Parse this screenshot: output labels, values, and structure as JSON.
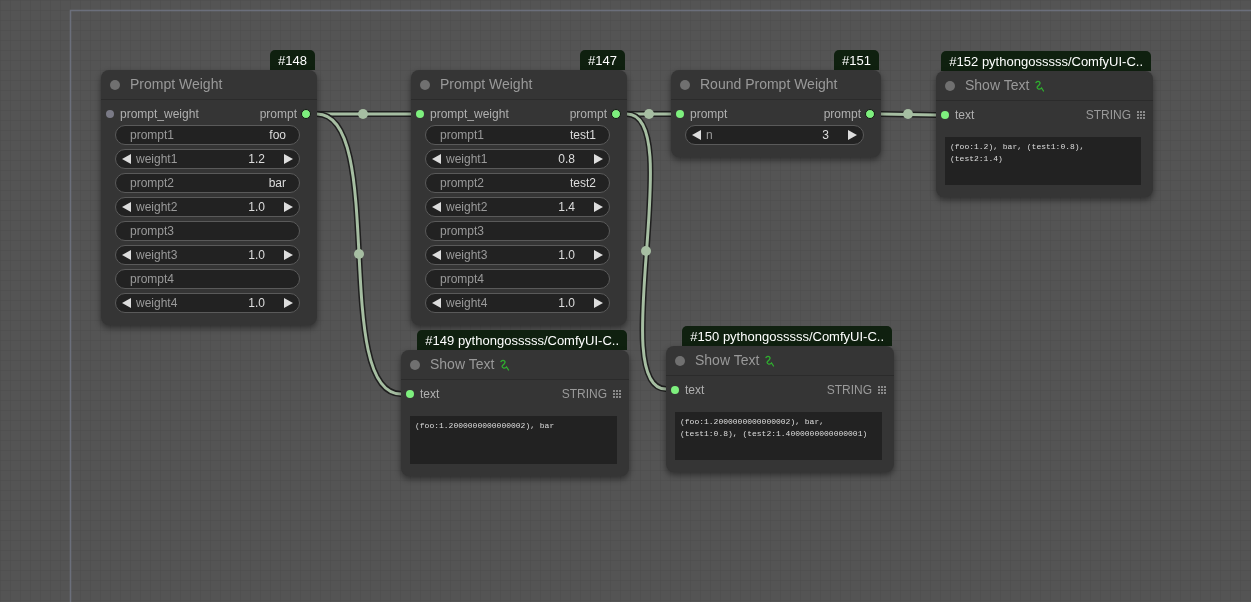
{
  "nodes": [
    {
      "kind": "widget",
      "badge": "#148",
      "title": "Prompt Weight",
      "inputs": [
        {
          "label": "prompt_weight",
          "connected": false
        }
      ],
      "outputs": [
        {
          "label": "prompt",
          "connected": true
        }
      ],
      "widgets": [
        {
          "kind": "text",
          "label": "prompt1",
          "value": "foo"
        },
        {
          "kind": "number",
          "label": "weight1",
          "value": "1.2"
        },
        {
          "kind": "text",
          "label": "prompt2",
          "value": "bar"
        },
        {
          "kind": "number",
          "label": "weight2",
          "value": "1.0"
        },
        {
          "kind": "text",
          "label": "prompt3"
        },
        {
          "kind": "number",
          "label": "weight3",
          "value": "1.0"
        },
        {
          "kind": "text",
          "label": "prompt4"
        },
        {
          "kind": "number",
          "label": "weight4",
          "value": "1.0"
        }
      ]
    },
    {
      "kind": "widget",
      "badge": "#147",
      "title": "Prompt Weight",
      "inputs": [
        {
          "label": "prompt_weight",
          "connected": true
        }
      ],
      "outputs": [
        {
          "label": "prompt",
          "connected": true
        }
      ],
      "widgets": [
        {
          "kind": "text",
          "label": "prompt1",
          "value": "test1"
        },
        {
          "kind": "number",
          "label": "weight1",
          "value": "0.8"
        },
        {
          "kind": "text",
          "label": "prompt2",
          "value": "test2"
        },
        {
          "kind": "number",
          "label": "weight2",
          "value": "1.4"
        },
        {
          "kind": "text",
          "label": "prompt3"
        },
        {
          "kind": "number",
          "label": "weight3",
          "value": "1.0"
        },
        {
          "kind": "text",
          "label": "prompt4"
        },
        {
          "kind": "number",
          "label": "weight4",
          "value": "1.0"
        }
      ]
    },
    {
      "kind": "widget",
      "badge": "#151",
      "title": "Round Prompt Weight",
      "inputs": [
        {
          "label": "prompt",
          "connected": true
        }
      ],
      "outputs": [
        {
          "label": "prompt",
          "connected": true
        }
      ],
      "widgets": [
        {
          "kind": "number",
          "label": "n",
          "value": "3"
        }
      ]
    },
    {
      "kind": "display",
      "badge": "#152 pythongosssss/ComfyUI-C..",
      "title": "Show Text",
      "inputs": [
        {
          "label": "text",
          "type": "STRING",
          "connected": true
        }
      ],
      "text": "(foo:1.2), bar, (test1:0.8), (test2:1.4)"
    },
    {
      "kind": "display",
      "badge": "#149 pythongosssss/ComfyUI-C..",
      "title": "Show Text",
      "inputs": [
        {
          "label": "text",
          "type": "STRING",
          "connected": true
        }
      ],
      "text": "(foo:1.2000000000000002), bar"
    },
    {
      "kind": "display",
      "badge": "#150 pythongosssss/ComfyUI-C..",
      "title": "Show Text",
      "inputs": [
        {
          "label": "text",
          "type": "STRING",
          "connected": true
        }
      ],
      "text": "(foo:1.2000000000000002), bar, (test1:0.8), (test2:1.4000000000000001)"
    }
  ]
}
